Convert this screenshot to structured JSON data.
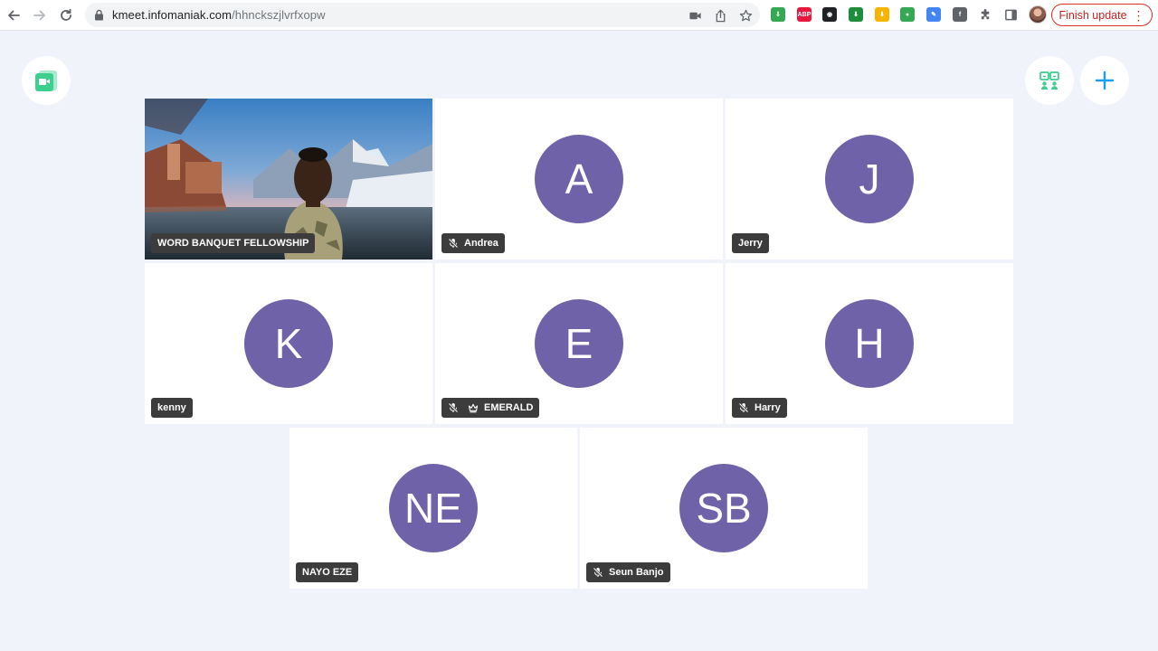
{
  "browser": {
    "url_host": "kmeet.infomaniak.com",
    "url_path": "/hhnckszjlvrfxopw",
    "update_label": "Finish update",
    "extensions": [
      {
        "name": "green-arrow-extension-icon",
        "color": "#34a853",
        "glyph": "⇩"
      },
      {
        "name": "adblock-plus-icon",
        "color": "#e8173d",
        "glyph": "ABP"
      },
      {
        "name": "black-mask-extension-icon",
        "color": "#202124",
        "glyph": "◉"
      },
      {
        "name": "green-download-extension-icon",
        "color": "#1e8e3e",
        "glyph": "⬇"
      },
      {
        "name": "yellow-download-extension-icon",
        "color": "#f4b400",
        "glyph": "⬇"
      },
      {
        "name": "globe-extension-icon",
        "color": "#34a853",
        "glyph": "●"
      },
      {
        "name": "blue-feather-extension-icon",
        "color": "#4285f4",
        "glyph": "✎"
      },
      {
        "name": "facebook-extension-icon",
        "color": "#5f6368",
        "glyph": "f"
      }
    ]
  },
  "colors": {
    "avatar": "#6f62a8",
    "tag_bg": "#3c3c3c",
    "accent_blue": "#1a9ef0",
    "brand_green": "#3ccf8e"
  },
  "participants": [
    {
      "id": "host",
      "name": "WORD BANQUET FELLOWSHIP",
      "initials": "",
      "video": true,
      "muted": false,
      "moderator": false
    },
    {
      "id": "andrea",
      "name": "Andrea",
      "initials": "A",
      "video": false,
      "muted": true,
      "moderator": false
    },
    {
      "id": "jerry",
      "name": "Jerry",
      "initials": "J",
      "video": false,
      "muted": false,
      "moderator": false
    },
    {
      "id": "kenny",
      "name": "kenny",
      "initials": "K",
      "video": false,
      "muted": false,
      "moderator": false
    },
    {
      "id": "emerald",
      "name": "EMERALD",
      "initials": "E",
      "video": false,
      "muted": true,
      "moderator": true
    },
    {
      "id": "harry",
      "name": "Harry",
      "initials": "H",
      "video": false,
      "muted": true,
      "moderator": false
    },
    {
      "id": "nayo",
      "name": "NAYO EZE",
      "initials": "NE",
      "video": false,
      "muted": false,
      "moderator": false
    },
    {
      "id": "seun",
      "name": "Seun Banjo",
      "initials": "SB",
      "video": false,
      "muted": true,
      "moderator": false
    }
  ]
}
